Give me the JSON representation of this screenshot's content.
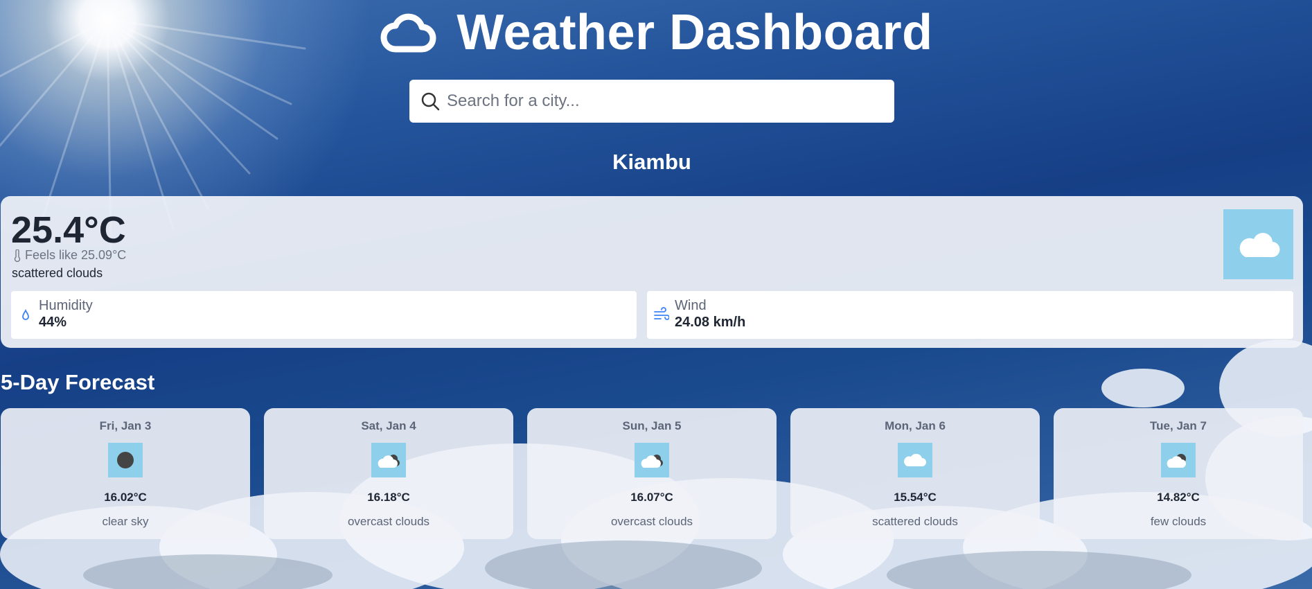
{
  "app": {
    "title": "Weather Dashboard",
    "logo_icon": "cloud-icon"
  },
  "search": {
    "placeholder": "Search for a city...",
    "value": "",
    "icon": "search-icon"
  },
  "current": {
    "city": "Kiambu",
    "temperature": "25.4°C",
    "feels_like": "Feels like 25.09°C",
    "description": "scattered clouds",
    "icon": "cloud-icon",
    "humidity": {
      "label": "Humidity",
      "value": "44%",
      "icon": "droplet-icon"
    },
    "wind": {
      "label": "Wind",
      "value": "24.08 km/h",
      "icon": "wind-icon"
    }
  },
  "forecast": {
    "title": "5-Day Forecast",
    "days": [
      {
        "date": "Fri, Jan 3",
        "temp": "16.02°C",
        "desc": "clear sky",
        "icon": "moon-icon"
      },
      {
        "date": "Sat, Jan 4",
        "temp": "16.18°C",
        "desc": "overcast clouds",
        "icon": "cloud-moon-icon"
      },
      {
        "date": "Sun, Jan 5",
        "temp": "16.07°C",
        "desc": "overcast clouds",
        "icon": "cloud-moon-icon"
      },
      {
        "date": "Mon, Jan 6",
        "temp": "15.54°C",
        "desc": "scattered clouds",
        "icon": "cloud-icon"
      },
      {
        "date": "Tue, Jan 7",
        "temp": "14.82°C",
        "desc": "few clouds",
        "icon": "partly-cloudy-moon-icon"
      }
    ]
  },
  "colors": {
    "icon_bg": "#8ecfeb",
    "text_dark": "#1e2533",
    "accent_blue": "#3b82f6"
  }
}
